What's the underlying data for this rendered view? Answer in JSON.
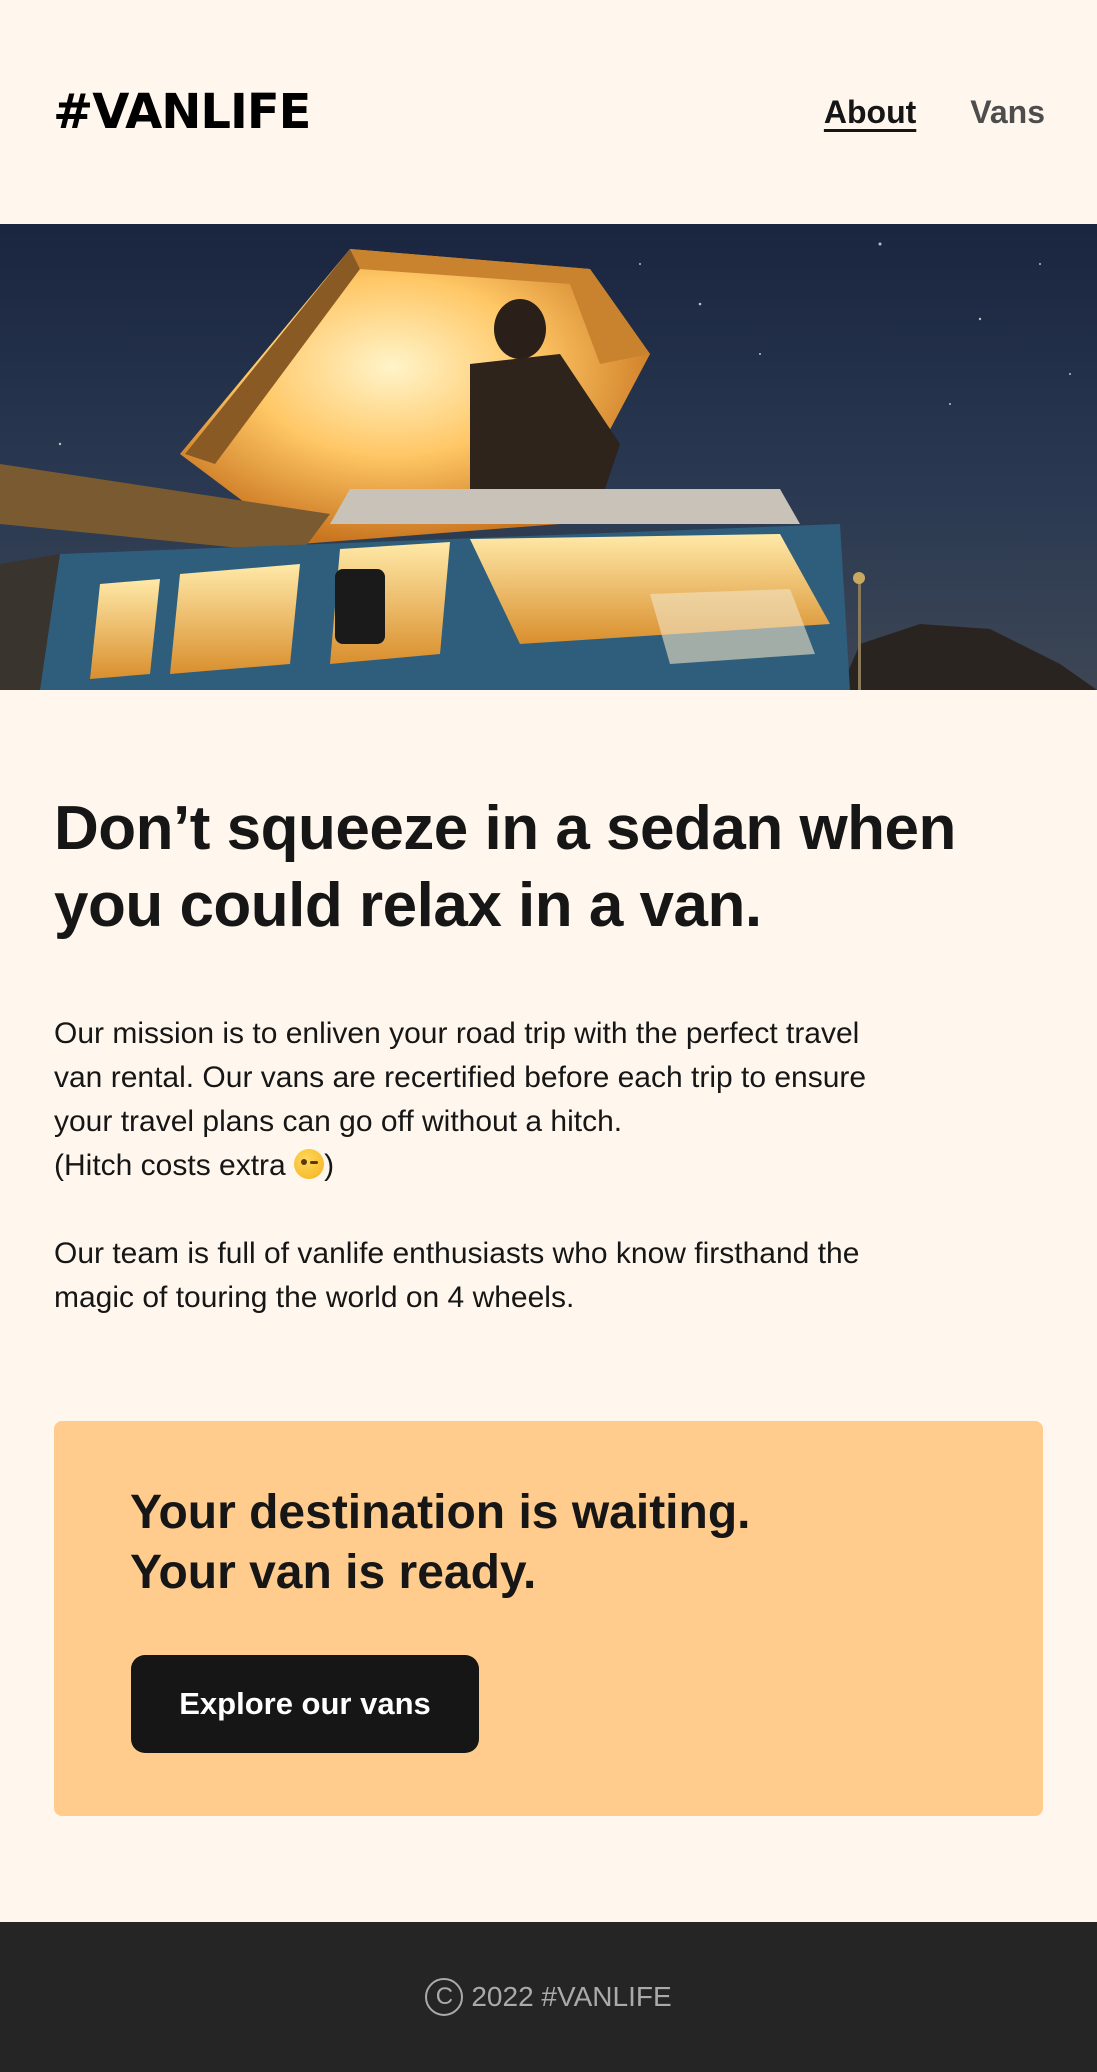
{
  "header": {
    "logo": "#VANLIFE",
    "nav": [
      {
        "label": "About",
        "active": true
      },
      {
        "label": "Vans",
        "active": false
      }
    ]
  },
  "hero": {
    "image_icon": "van-night-camping-image"
  },
  "main": {
    "headline_line1": "Don’t squeeze in a sedan when",
    "headline_line2": "you could relax in a van.",
    "mission_line1": "Our mission is to enliven your road trip with the perfect travel",
    "mission_line2": "van rental. Our vans are recertified before each trip to ensure",
    "mission_line3": "your travel plans can go off without a hitch.",
    "hitch_text_before": "(Hitch costs extra ",
    "hitch_emoji_icon": "wink-emoji-icon",
    "hitch_text_after": ")",
    "team_line1": "Our team is full of vanlife enthusiasts who know firsthand the",
    "team_line2": "magic of touring the world on 4 wheels."
  },
  "cta": {
    "title_line1": "Your destination is waiting.",
    "title_line2": "Your van is ready.",
    "button_label": "Explore our vans"
  },
  "footer": {
    "copyright_icon": "copyright-icon",
    "text": "2022 #VANLIFE"
  },
  "colors": {
    "background": "#FFF7ED",
    "cta_background": "#FFCC8D",
    "button": "#161616",
    "footer": "#252525",
    "footer_text": "#AAAAAA"
  }
}
